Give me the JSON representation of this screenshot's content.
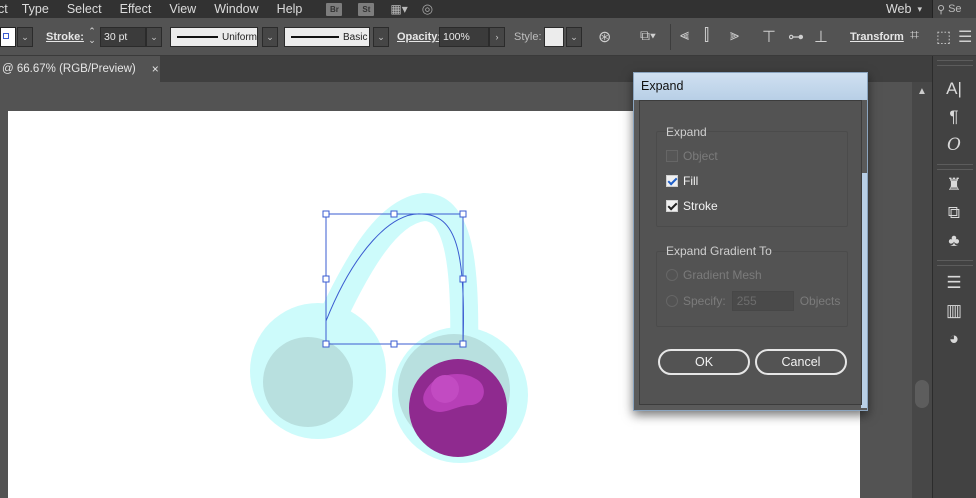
{
  "menubar": {
    "items": [
      "ct",
      "Type",
      "Select",
      "Effect",
      "View",
      "Window",
      "Help"
    ],
    "badges": [
      "Br",
      "St"
    ],
    "workspace": "Web",
    "search_placeholder": "Se"
  },
  "controlbar": {
    "stroke_label": "Stroke:",
    "stroke_value": "30 pt",
    "profile_label": "Uniform",
    "brush_label": "Basic",
    "opacity_label": "Opacity:",
    "opacity_value": "100%",
    "style_label": "Style:",
    "transform_label": "Transform"
  },
  "document_tab": {
    "title": "@ 66.67% (RGB/Preview)",
    "close_glyph": "×"
  },
  "dialog": {
    "title": "Expand",
    "expand_group": {
      "title": "Expand",
      "options": [
        {
          "label": "Object",
          "checked": false,
          "enabled": false
        },
        {
          "label": "Fill",
          "checked": true,
          "enabled": true
        },
        {
          "label": "Stroke",
          "checked": true,
          "enabled": true
        }
      ]
    },
    "gradient_group": {
      "title": "Expand Gradient To",
      "gradient_mesh_label": "Gradient Mesh",
      "specify_label": "Specify:",
      "specify_value": "255",
      "objects_label": "Objects"
    },
    "ok_label": "OK",
    "cancel_label": "Cancel"
  },
  "colors": {
    "cherry_glow": "#cdfbfb",
    "left_cherry": "#b8e0df",
    "right_cherry": "#8f2a8f",
    "cherry_highlight": "#b73fb7",
    "selection": "#3a5bd0",
    "dialog_title_bg": "#c6dbef",
    "check_blue": "#2060c8"
  }
}
